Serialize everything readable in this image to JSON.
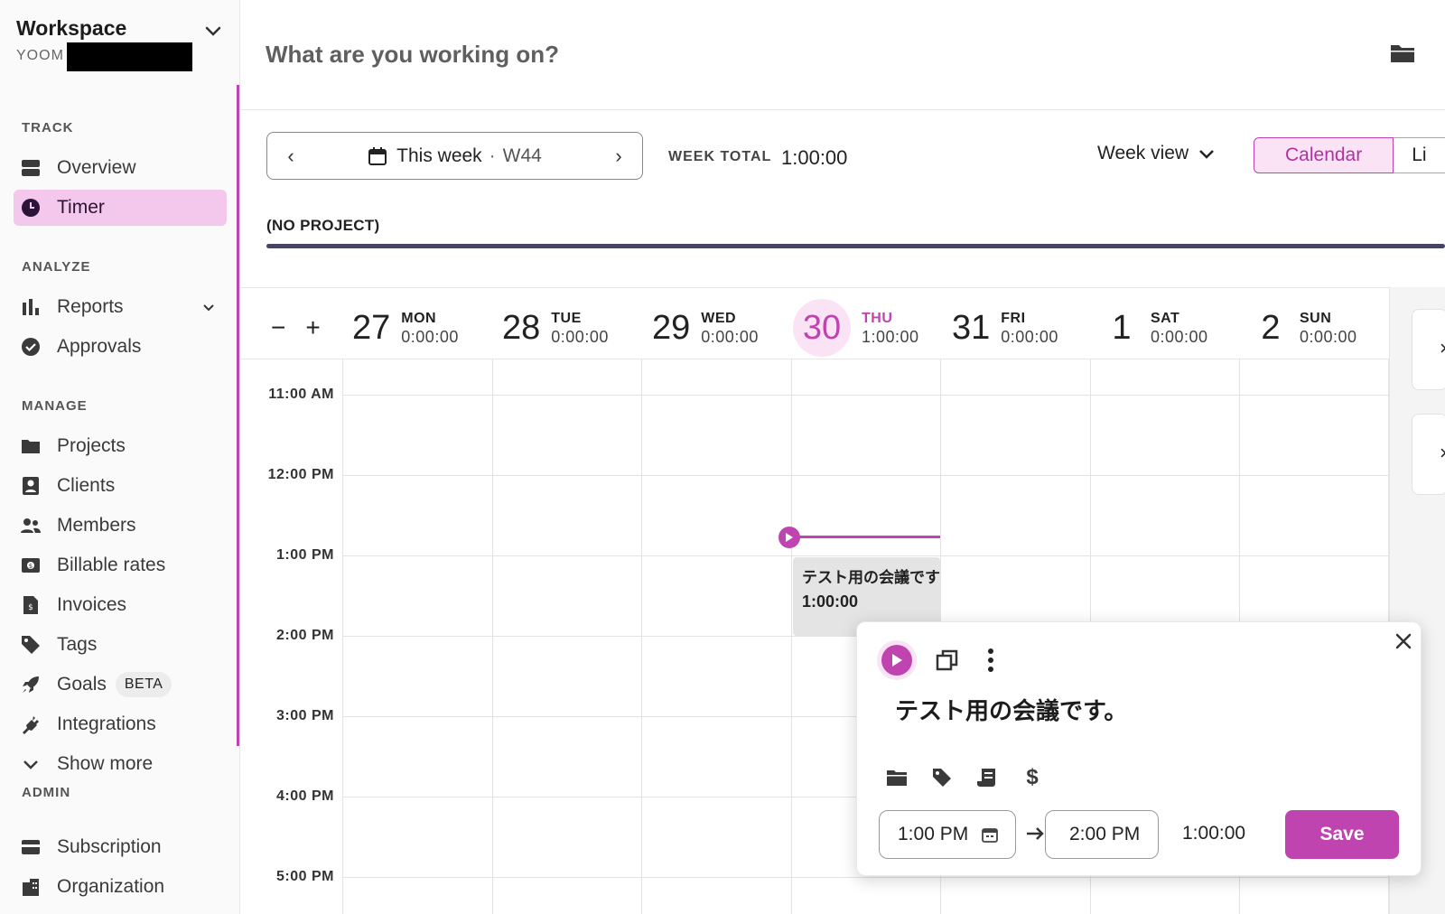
{
  "workspace": {
    "title": "Workspace",
    "subtitle": "YOOM"
  },
  "sidebar": {
    "sections": [
      {
        "label": "TRACK"
      },
      {
        "label": "ANALYZE"
      },
      {
        "label": "MANAGE"
      },
      {
        "label": "ADMIN"
      }
    ],
    "items": {
      "overview": "Overview",
      "timer": "Timer",
      "reports": "Reports",
      "approvals": "Approvals",
      "projects": "Projects",
      "clients": "Clients",
      "members": "Members",
      "billable_rates": "Billable rates",
      "invoices": "Invoices",
      "tags": "Tags",
      "goals": "Goals",
      "goals_badge": "BETA",
      "integrations": "Integrations",
      "show_more": "Show more",
      "subscription": "Subscription",
      "organization": "Organization"
    }
  },
  "topbar": {
    "placeholder": "What are you working on?"
  },
  "week": {
    "label": "This week",
    "separator": "·",
    "number": "W44",
    "total_label": "WEEK TOTAL",
    "total_value": "1:00:00",
    "view_label": "Week view",
    "tab_calendar": "Calendar",
    "tab_list": "Li"
  },
  "project_summary": {
    "label": "(NO PROJECT)"
  },
  "calendar": {
    "zoom_out": "−",
    "zoom_in": "+",
    "days": [
      {
        "num": "27",
        "name": "MON",
        "total": "0:00:00"
      },
      {
        "num": "28",
        "name": "TUE",
        "total": "0:00:00"
      },
      {
        "num": "29",
        "name": "WED",
        "total": "0:00:00"
      },
      {
        "num": "30",
        "name": "THU",
        "total": "1:00:00"
      },
      {
        "num": "31",
        "name": "FRI",
        "total": "0:00:00"
      },
      {
        "num": "1",
        "name": "SAT",
        "total": "0:00:00"
      },
      {
        "num": "2",
        "name": "SUN",
        "total": "0:00:00"
      }
    ],
    "times": [
      "11:00 AM",
      "12:00 PM",
      "1:00 PM",
      "2:00 PM",
      "3:00 PM",
      "4:00 PM",
      "5:00 PM"
    ],
    "entry": {
      "title": "テスト用の会議です",
      "duration": "1:00:00"
    }
  },
  "popover": {
    "description": "テスト用の会議です。",
    "start": "1:00 PM",
    "end": "2:00 PM",
    "duration": "1:00:00",
    "save": "Save"
  },
  "colors": {
    "accent": "#c044b0",
    "accent_light": "#fbe3f6",
    "project_bar": "#454462"
  }
}
